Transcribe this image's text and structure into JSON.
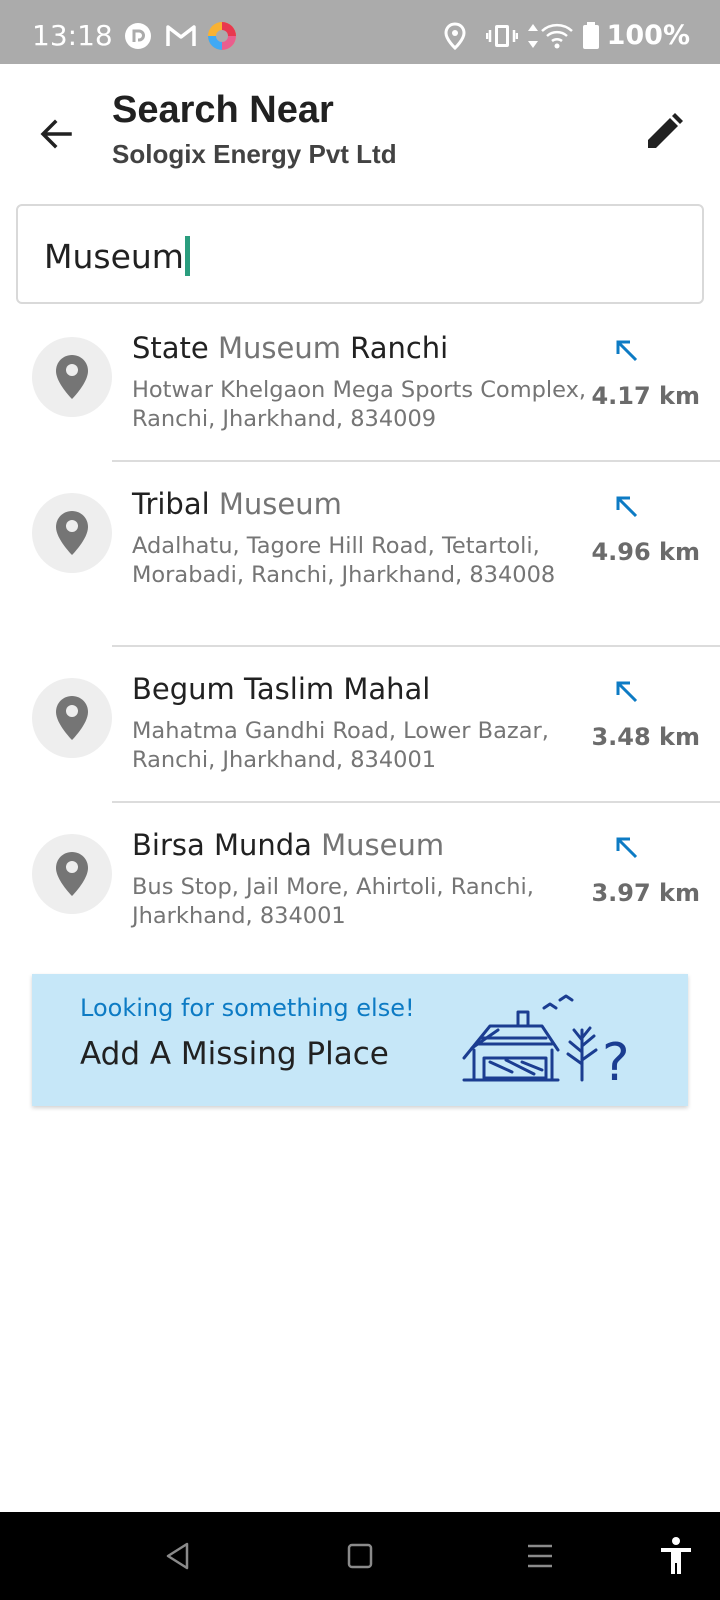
{
  "status_bar": {
    "time": "13:18",
    "battery": "100%",
    "left_icons": [
      "pocket-casts-icon",
      "gmail-icon",
      "app-color-icon"
    ],
    "right_icons": [
      "location-icon",
      "vibrate-icon",
      "data-arrows-icon",
      "wifi-icon",
      "battery-icon"
    ]
  },
  "header": {
    "title": "Search Near",
    "subtitle": "Sologix Energy Pvt Ltd"
  },
  "search": {
    "value": "Museum"
  },
  "results": [
    {
      "name_parts": [
        "State ",
        "Museum",
        " Ranchi"
      ],
      "address": "Hotwar Khelgaon Mega Sports Complex, Ranchi, Jharkhand, 834009",
      "distance": "4.17 km"
    },
    {
      "name_parts": [
        "Tribal ",
        "Museum",
        ""
      ],
      "address": "Adalhatu, Tagore Hill Road, Tetartoli, Morabadi, Ranchi, Jharkhand, 834008",
      "distance": "4.96 km"
    },
    {
      "name_parts": [
        "Begum Taslim Mahal",
        "",
        ""
      ],
      "address": "Mahatma Gandhi Road, Lower Bazar, Ranchi, Jharkhand, 834001",
      "distance": "3.48 km"
    },
    {
      "name_parts": [
        "Birsa Munda ",
        "Museum",
        ""
      ],
      "address": "Bus Stop, Jail More, Ahirtoli, Ranchi, Jharkhand, 834001",
      "distance": "3.97 km"
    }
  ],
  "missing_place": {
    "subtitle": "Looking for something else!",
    "title": "Add A Missing Place"
  },
  "colors": {
    "accent_blue": "#0d7bc4",
    "card_bg": "#c6e7f8",
    "caret": "#2a9d7e",
    "illustration": "#1b3d91"
  }
}
